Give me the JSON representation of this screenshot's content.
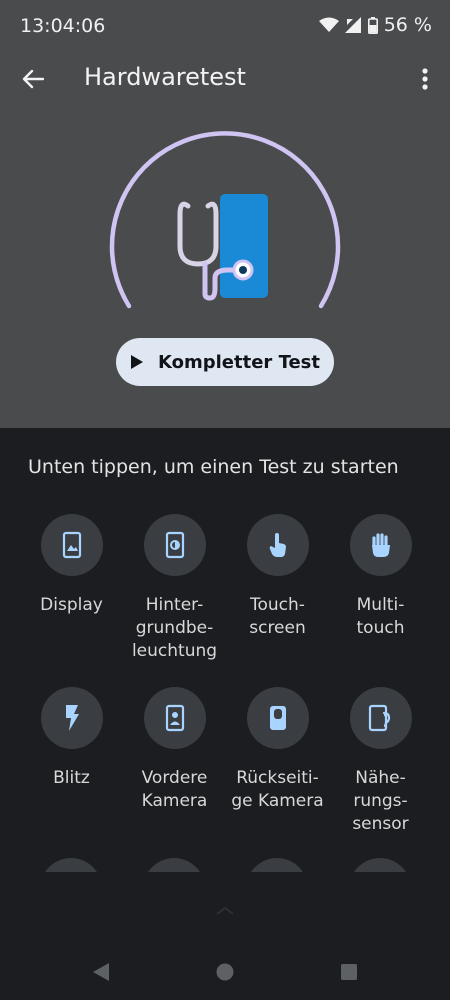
{
  "status": {
    "time": "13:04:06",
    "battery": "56 %"
  },
  "appbar": {
    "title": "Hardwaretest"
  },
  "main": {
    "full_test_label": "Kompletter Test",
    "hint": "Unten tippen, um einen Test zu starten"
  },
  "tests": [
    {
      "label": "Display",
      "icon": "display-icon"
    },
    {
      "label": "Hinter-\ngrundbe-\nleuchtung",
      "icon": "backlight-icon"
    },
    {
      "label": "Touch-\nscreen",
      "icon": "touch-icon"
    },
    {
      "label": "Multi-\ntouch",
      "icon": "multitouch-icon"
    },
    {
      "label": "Blitz",
      "icon": "flash-icon"
    },
    {
      "label": "Vordere\nKamera",
      "icon": "front-camera-icon"
    },
    {
      "label": "Rückseiti-\nge Kamera",
      "icon": "rear-camera-icon"
    },
    {
      "label": "Nähe-\nrungs-\nsensor",
      "icon": "proximity-sensor-icon"
    }
  ],
  "colors": {
    "accent": "#cfc4f2",
    "phone_blue": "#1a8ad6",
    "button_bg": "#dfe8f2",
    "header_bg": "#4a4b4d",
    "body_bg": "#1b1d20"
  }
}
